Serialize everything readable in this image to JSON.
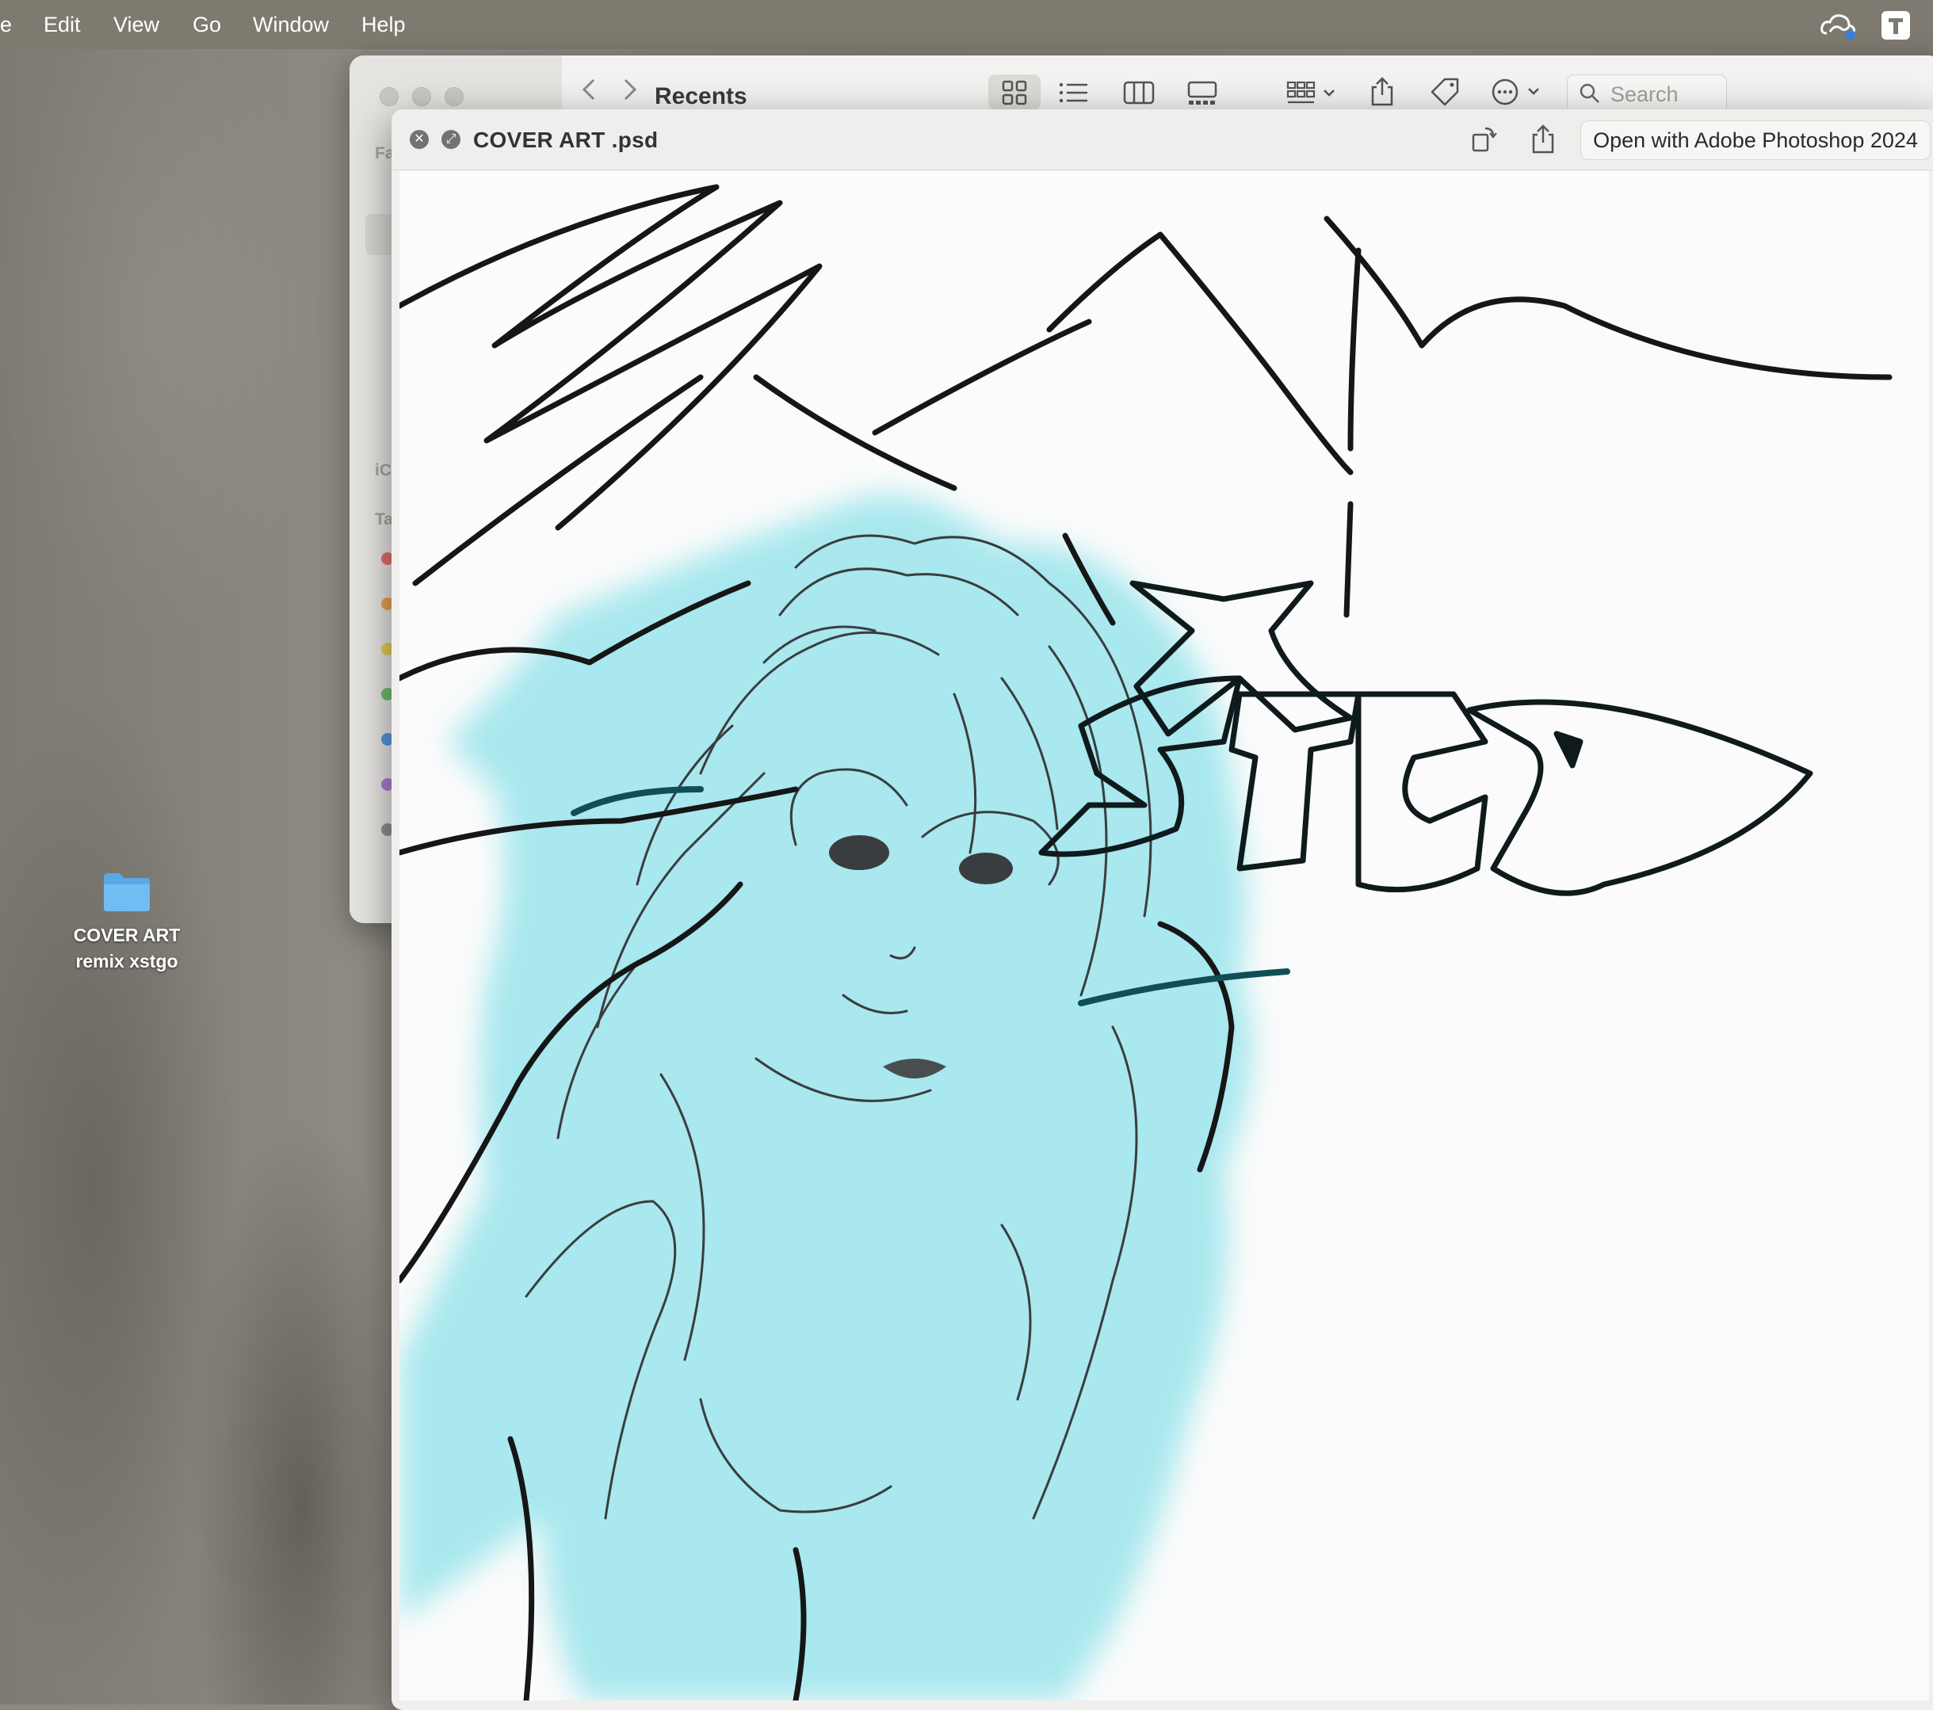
{
  "menubar": {
    "items": [
      "e",
      "Edit",
      "View",
      "Go",
      "Window",
      "Help"
    ]
  },
  "finder": {
    "location": "Recents",
    "search_placeholder": "Search",
    "sidebar_fragments": [
      "Fa",
      "iC",
      "Ta"
    ],
    "tag_colors": [
      "#e0706a",
      "#e8a352",
      "#e6cc56",
      "#6cbf6a",
      "#5a95dd",
      "#b07ad0",
      "#8e8e8e"
    ]
  },
  "quicklook": {
    "file_name": "COVER ART .psd",
    "open_with_label": "Open with Adobe Photoshop 2024"
  },
  "desktop": {
    "folder_name_line1": "COVER ART",
    "folder_name_line2": "remix xstgo"
  },
  "colors": {
    "wash": "#a8e8ee",
    "ink": "#1a1a1a"
  }
}
